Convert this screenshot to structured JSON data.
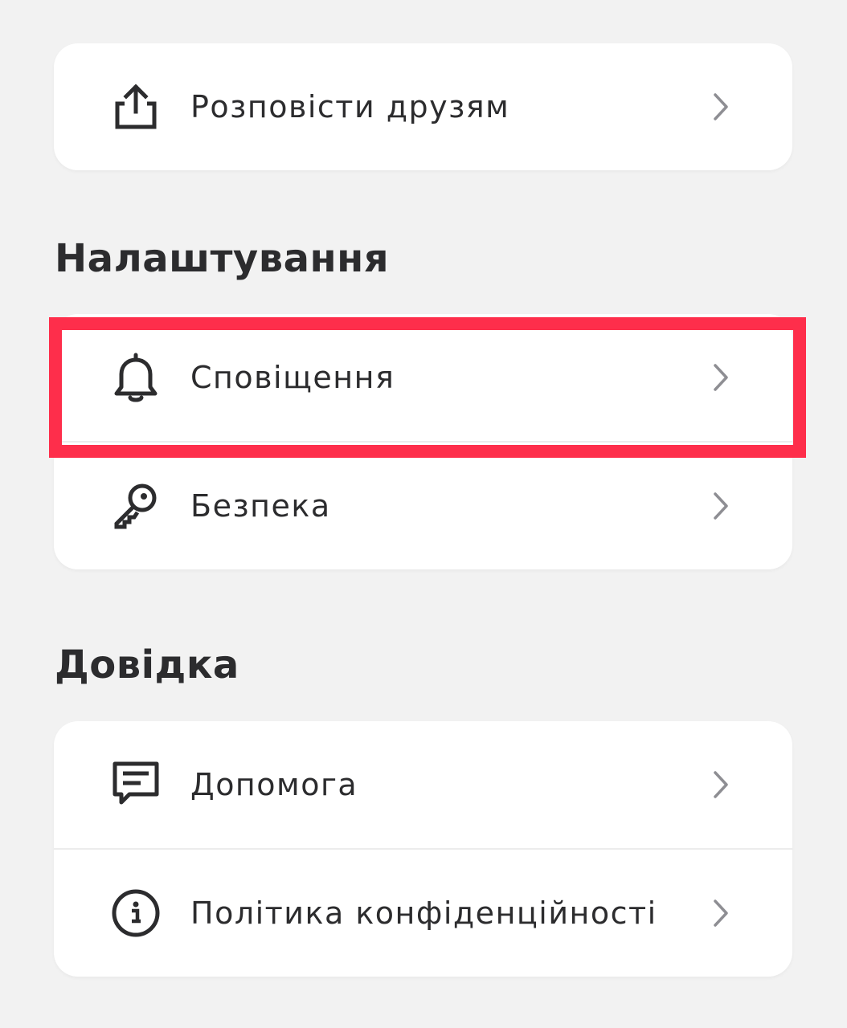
{
  "share_card": {
    "items": [
      {
        "label": "Розповісти друзям",
        "icon": "share-icon"
      }
    ]
  },
  "settings": {
    "title": "Налаштування",
    "items": [
      {
        "label": "Сповіщення",
        "icon": "bell-icon"
      },
      {
        "label": "Безпека",
        "icon": "key-icon"
      }
    ]
  },
  "help": {
    "title": "Довідка",
    "items": [
      {
        "label": "Допомога",
        "icon": "message-icon"
      },
      {
        "label": "Політика конфіденційності",
        "icon": "info-icon"
      }
    ]
  },
  "highlight_color": "#fe2e4b",
  "chevron_icon": "chevron-right-icon"
}
